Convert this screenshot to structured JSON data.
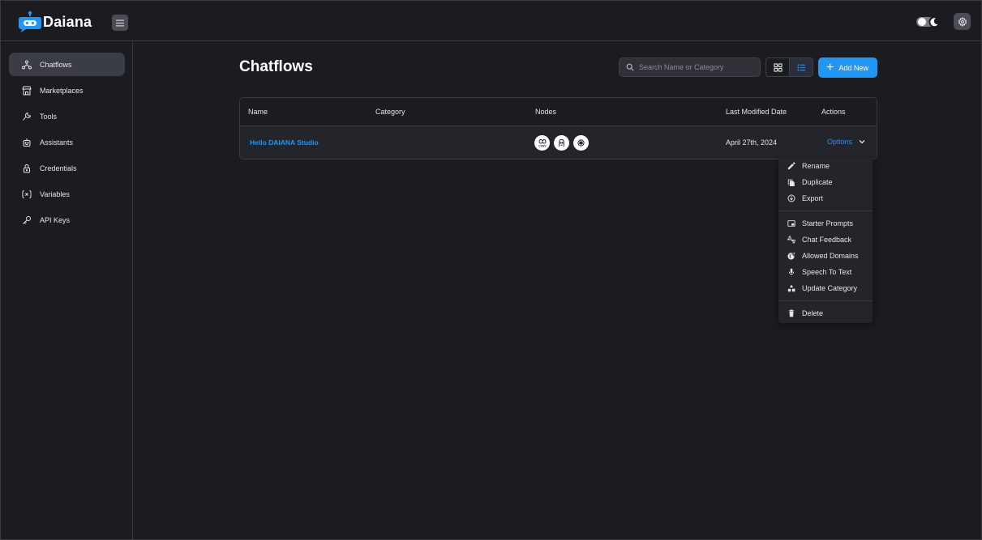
{
  "app": {
    "name": "Daiana"
  },
  "sidebar": {
    "items": [
      {
        "label": "Chatflows",
        "icon": "hierarchy-icon",
        "active": true
      },
      {
        "label": "Marketplaces",
        "icon": "building-store-icon"
      },
      {
        "label": "Tools",
        "icon": "tool-icon"
      },
      {
        "label": "Assistants",
        "icon": "robot-icon"
      },
      {
        "label": "Credentials",
        "icon": "lock-icon"
      },
      {
        "label": "Variables",
        "icon": "variable-icon"
      },
      {
        "label": "API Keys",
        "icon": "key-icon"
      }
    ]
  },
  "main": {
    "title": "Chatflows",
    "search_placeholder": "Search Name or Category",
    "add_button": "Add New",
    "table": {
      "headers": [
        "Name",
        "Category",
        "Nodes",
        "Last Modified Date",
        "Actions"
      ],
      "rows": [
        {
          "name": "Hello DAIANA Studio",
          "category": "",
          "node_icons": [
            "conversation-chain-icon",
            "memory-icon",
            "openai-icon"
          ],
          "node_icon_text": "CONV",
          "last_modified": "April 27th, 2024",
          "actions_label": "Options"
        }
      ]
    }
  },
  "options_menu": {
    "items": [
      {
        "label": "Rename",
        "icon": "pencil-icon"
      },
      {
        "label": "Duplicate",
        "icon": "copy-icon"
      },
      {
        "label": "Export",
        "icon": "export-icon"
      },
      {
        "label": "Starter Prompts",
        "icon": "picture-in-picture-icon"
      },
      {
        "label": "Chat Feedback",
        "icon": "thumbs-feedback-icon"
      },
      {
        "label": "Allowed Domains",
        "icon": "globe-icon"
      },
      {
        "label": "Speech To Text",
        "icon": "microphone-icon"
      },
      {
        "label": "Update Category",
        "icon": "category-icon"
      },
      {
        "label": "Delete",
        "icon": "trash-icon"
      }
    ]
  },
  "colors": {
    "accent": "#2196f3",
    "background": "#1b1c20",
    "surface": "#24252b"
  }
}
